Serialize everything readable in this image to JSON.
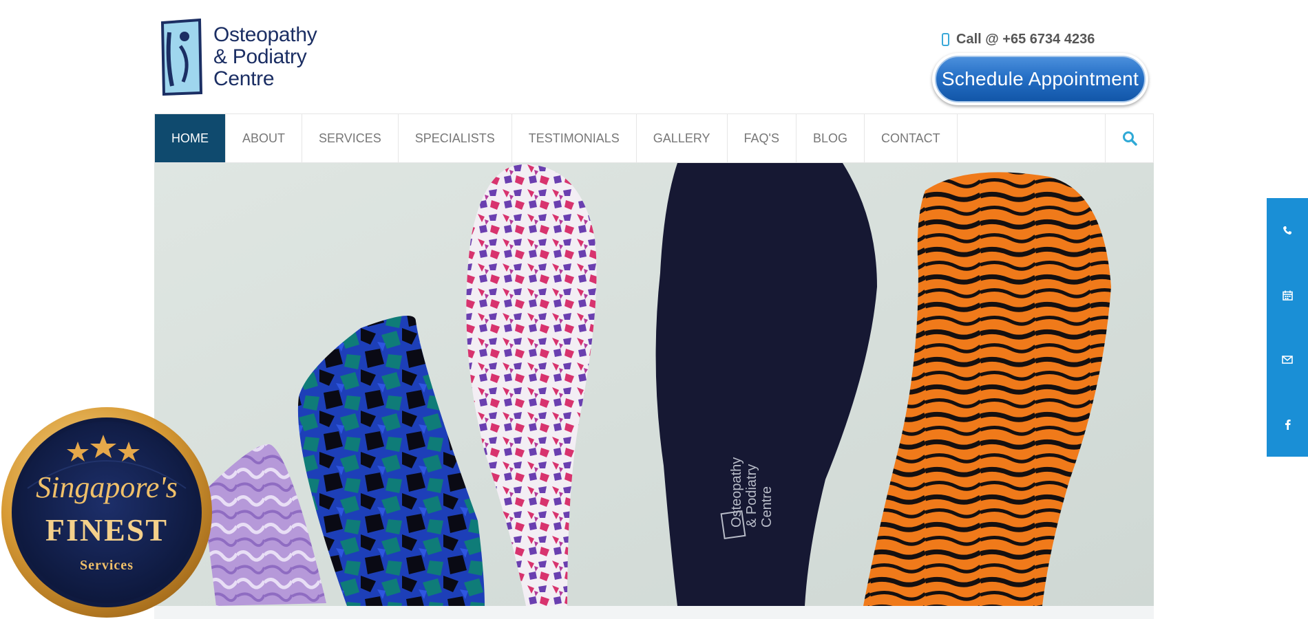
{
  "header": {
    "logo_line1": "Osteopathy",
    "logo_line2": "& Podiatry",
    "logo_line3": "Centre",
    "call_text": "Call @ +65 6734 4236",
    "schedule_label": "Schedule Appointment"
  },
  "nav": {
    "items": [
      {
        "label": "HOME",
        "active": true
      },
      {
        "label": "ABOUT"
      },
      {
        "label": "SERVICES"
      },
      {
        "label": "SPECIALISTS"
      },
      {
        "label": "TESTIMONIALS"
      },
      {
        "label": "GALLERY"
      },
      {
        "label": "FAQ'S"
      },
      {
        "label": "BLOG"
      },
      {
        "label": "CONTACT"
      }
    ],
    "search_icon": "search-icon"
  },
  "hero": {
    "insole_print_line1": "Osteopathy",
    "insole_print_line2": "& Podiatry",
    "insole_print_line3": "Centre"
  },
  "side_bar": {
    "icons": [
      "phone-icon",
      "calendar-icon",
      "mail-icon",
      "facebook-icon"
    ]
  },
  "badge": {
    "line1": "Singapore's",
    "line2": "FINEST",
    "line3": "Services"
  },
  "colors": {
    "nav_active": "#0f4a6e",
    "accent_blue": "#1a8fd6",
    "logo_navy": "#1b2e63",
    "badge_gold": "#e0a94a"
  }
}
